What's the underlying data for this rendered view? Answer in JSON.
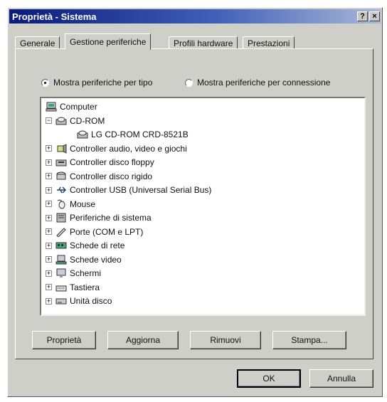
{
  "window": {
    "title": "Proprietà - Sistema",
    "help_label": "?",
    "close_label": "×"
  },
  "tabs": [
    {
      "label": "Generale",
      "active": false
    },
    {
      "label": "Gestione periferiche",
      "active": true
    },
    {
      "label": "Profili hardware",
      "active": false
    },
    {
      "label": "Prestazioni",
      "active": false
    }
  ],
  "view_options": {
    "by_type": {
      "label": "Mostra periferiche per tipo",
      "selected": true
    },
    "by_connection": {
      "label": "Mostra periferiche per connessione",
      "selected": false
    }
  },
  "device_tree": [
    {
      "label": "Computer",
      "level": 0,
      "expander": "",
      "icon": "computer-icon"
    },
    {
      "label": "CD-ROM",
      "level": 1,
      "expander": "−",
      "icon": "cdrom-icon"
    },
    {
      "label": "LG CD-ROM CRD-8521B",
      "level": 2,
      "expander": "",
      "icon": "cdrom-icon"
    },
    {
      "label": "Controller audio, video e giochi",
      "level": 1,
      "expander": "+",
      "icon": "audio-icon"
    },
    {
      "label": "Controller disco floppy",
      "level": 1,
      "expander": "+",
      "icon": "floppy-controller-icon"
    },
    {
      "label": "Controller disco rigido",
      "level": 1,
      "expander": "+",
      "icon": "disk-controller-icon"
    },
    {
      "label": "Controller USB (Universal Serial Bus)",
      "level": 1,
      "expander": "+",
      "icon": "usb-icon"
    },
    {
      "label": "Mouse",
      "level": 1,
      "expander": "+",
      "icon": "mouse-icon"
    },
    {
      "label": "Periferiche di sistema",
      "level": 1,
      "expander": "+",
      "icon": "system-device-icon"
    },
    {
      "label": "Porte (COM e LPT)",
      "level": 1,
      "expander": "+",
      "icon": "port-icon"
    },
    {
      "label": "Schede di rete",
      "level": 1,
      "expander": "+",
      "icon": "network-card-icon"
    },
    {
      "label": "Schede video",
      "level": 1,
      "expander": "+",
      "icon": "video-card-icon"
    },
    {
      "label": "Schermi",
      "level": 1,
      "expander": "+",
      "icon": "monitor-icon"
    },
    {
      "label": "Tastiera",
      "level": 1,
      "expander": "+",
      "icon": "keyboard-icon"
    },
    {
      "label": "Unità disco",
      "level": 1,
      "expander": "+",
      "icon": "disk-drive-icon"
    }
  ],
  "buttons": {
    "properties": "Proprietà",
    "refresh": "Aggiorna",
    "remove": "Rimuovi",
    "print": "Stampa...",
    "ok": "OK",
    "cancel": "Annulla"
  },
  "colors": {
    "title_start": "#0a1a7a",
    "title_end": "#a8b8d8",
    "dialog_face": "#cfcfca"
  }
}
